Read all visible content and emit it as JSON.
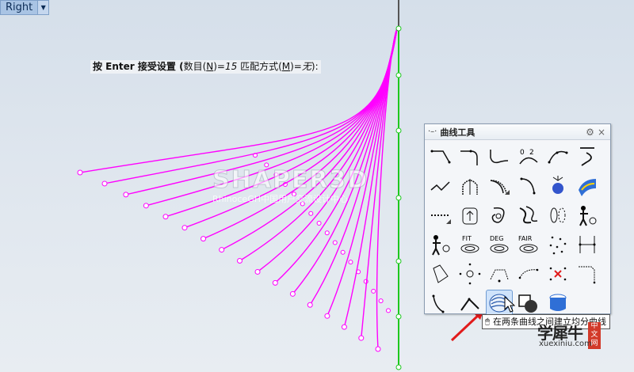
{
  "viewport": {
    "label": "Right",
    "dropdown_icon": "caret-down-icon"
  },
  "prompt": {
    "prefix": "按 Enter 接受设置 (",
    "count_label": "数目(",
    "count_key": "N",
    "count_eq": ")=",
    "count_value": "15",
    "match_label": "  匹配方式(",
    "match_key": "M",
    "match_eq": ")=",
    "match_value": "无",
    "suffix": "):"
  },
  "watermark": {
    "brand": "SHAPER3D",
    "subtitle": "RhinoceGH中国用户交流设计中心"
  },
  "toolbar": {
    "title": "曲线工具",
    "title_icon": "curve-icon",
    "gear_icon": "gear-icon",
    "close_icon": "close-icon",
    "labels": {
      "fit": "FIT",
      "deg": "DEG",
      "fair": "FAIR",
      "two": "2",
      "zero": "0"
    }
  },
  "tooltip": {
    "mouse_icon": "mouse-left-icon",
    "text": "在两条曲线之间建立均分曲线"
  },
  "logo": {
    "brand": "学犀牛",
    "tag": "中文网",
    "url": "xuexiniu.com"
  },
  "colors": {
    "curves": "#ff00ff",
    "axis": "#1ec81e",
    "accent": "#e11b1b"
  }
}
